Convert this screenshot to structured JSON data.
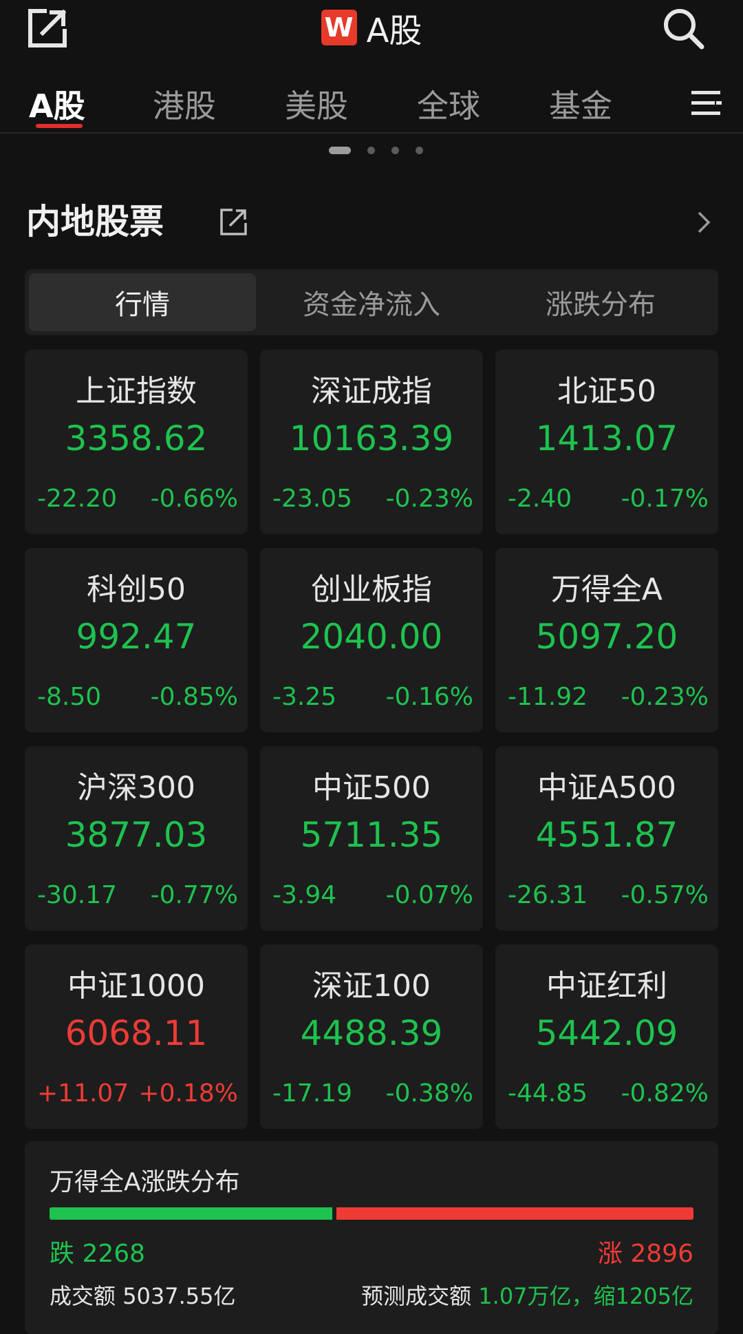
{
  "header": {
    "logo_letter": "W",
    "title": "A股"
  },
  "tabs": [
    {
      "label": "A股",
      "active": true
    },
    {
      "label": "港股",
      "active": false
    },
    {
      "label": "美股",
      "active": false
    },
    {
      "label": "全球",
      "active": false
    },
    {
      "label": "基金",
      "active": false
    }
  ],
  "carousel": {
    "page_count": 4,
    "active_index": 0
  },
  "section": {
    "title": "内地股票"
  },
  "segments": [
    {
      "label": "行情",
      "active": true
    },
    {
      "label": "资金净流入",
      "active": false
    },
    {
      "label": "涨跌分布",
      "active": false
    }
  ],
  "colors": {
    "down": "#1ec24f",
    "up": "#ef3b36",
    "accent": "#e0302a",
    "logo_bg": "#e63a2b"
  },
  "indices": [
    {
      "name": "上证指数",
      "price": "3358.62",
      "change": "-22.20",
      "percent": "-0.66%",
      "trend": "down"
    },
    {
      "name": "深证成指",
      "price": "10163.39",
      "change": "-23.05",
      "percent": "-0.23%",
      "trend": "down"
    },
    {
      "name": "北证50",
      "price": "1413.07",
      "change": "-2.40",
      "percent": "-0.17%",
      "trend": "down"
    },
    {
      "name": "科创50",
      "price": "992.47",
      "change": "-8.50",
      "percent": "-0.85%",
      "trend": "down"
    },
    {
      "name": "创业板指",
      "price": "2040.00",
      "change": "-3.25",
      "percent": "-0.16%",
      "trend": "down"
    },
    {
      "name": "万得全A",
      "price": "5097.20",
      "change": "-11.92",
      "percent": "-0.23%",
      "trend": "down"
    },
    {
      "name": "沪深300",
      "price": "3877.03",
      "change": "-30.17",
      "percent": "-0.77%",
      "trend": "down"
    },
    {
      "name": "中证500",
      "price": "5711.35",
      "change": "-3.94",
      "percent": "-0.07%",
      "trend": "down"
    },
    {
      "name": "中证A500",
      "price": "4551.87",
      "change": "-26.31",
      "percent": "-0.57%",
      "trend": "down"
    },
    {
      "name": "中证1000",
      "price": "6068.11",
      "change": "+11.07",
      "percent": "+0.18%",
      "trend": "up"
    },
    {
      "name": "深证100",
      "price": "4488.39",
      "change": "-17.19",
      "percent": "-0.38%",
      "trend": "down"
    },
    {
      "name": "中证红利",
      "price": "5442.09",
      "change": "-44.85",
      "percent": "-0.82%",
      "trend": "down"
    }
  ],
  "distribution": {
    "title": "万得全A涨跌分布",
    "down_label": "跌",
    "down_count": 2268,
    "up_label": "涨",
    "up_count": 2896,
    "turnover_label": "成交额",
    "turnover_value": "5037.55亿",
    "forecast_label": "预测成交额",
    "forecast_value": "1.07万亿，缩1205亿"
  }
}
